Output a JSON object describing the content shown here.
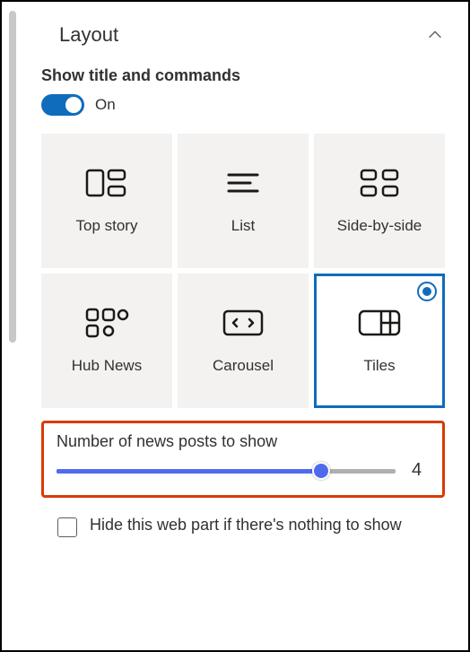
{
  "section": {
    "title": "Layout",
    "expanded": true
  },
  "toggle": {
    "heading": "Show title and commands",
    "stateLabel": "On",
    "on": true
  },
  "layouts": [
    {
      "id": "top-story",
      "label": "Top story",
      "selected": false
    },
    {
      "id": "list",
      "label": "List",
      "selected": false
    },
    {
      "id": "side-by-side",
      "label": "Side-by-side",
      "selected": false
    },
    {
      "id": "hub-news",
      "label": "Hub News",
      "selected": false
    },
    {
      "id": "carousel",
      "label": "Carousel",
      "selected": false
    },
    {
      "id": "tiles",
      "label": "Tiles",
      "selected": true
    }
  ],
  "slider": {
    "label": "Number of news posts to show",
    "value": "4"
  },
  "hideEmpty": {
    "label": "Hide this web part if there's nothing to show",
    "checked": false
  }
}
